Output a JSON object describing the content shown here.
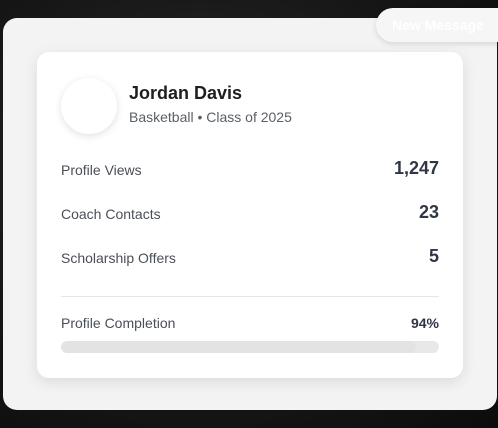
{
  "new_message": {
    "label": "New Message"
  },
  "profile": {
    "name": "Jordan Davis",
    "subtitle": "Basketball • Class of 2025"
  },
  "stats": [
    {
      "label": "Profile Views",
      "value": "1,247"
    },
    {
      "label": "Coach Contacts",
      "value": "23"
    },
    {
      "label": "Scholarship Offers",
      "value": "5"
    }
  ],
  "completion": {
    "label": "Profile Completion",
    "value_text": "94%",
    "percent": 94
  },
  "colors": {
    "card_background": "#ffffff",
    "panel_background": "#f3f3f3",
    "text_primary": "#1f1f1f",
    "text_secondary": "#5a5f66",
    "stat_value": "#2f3744",
    "progress_track": "#e8e8e8"
  }
}
